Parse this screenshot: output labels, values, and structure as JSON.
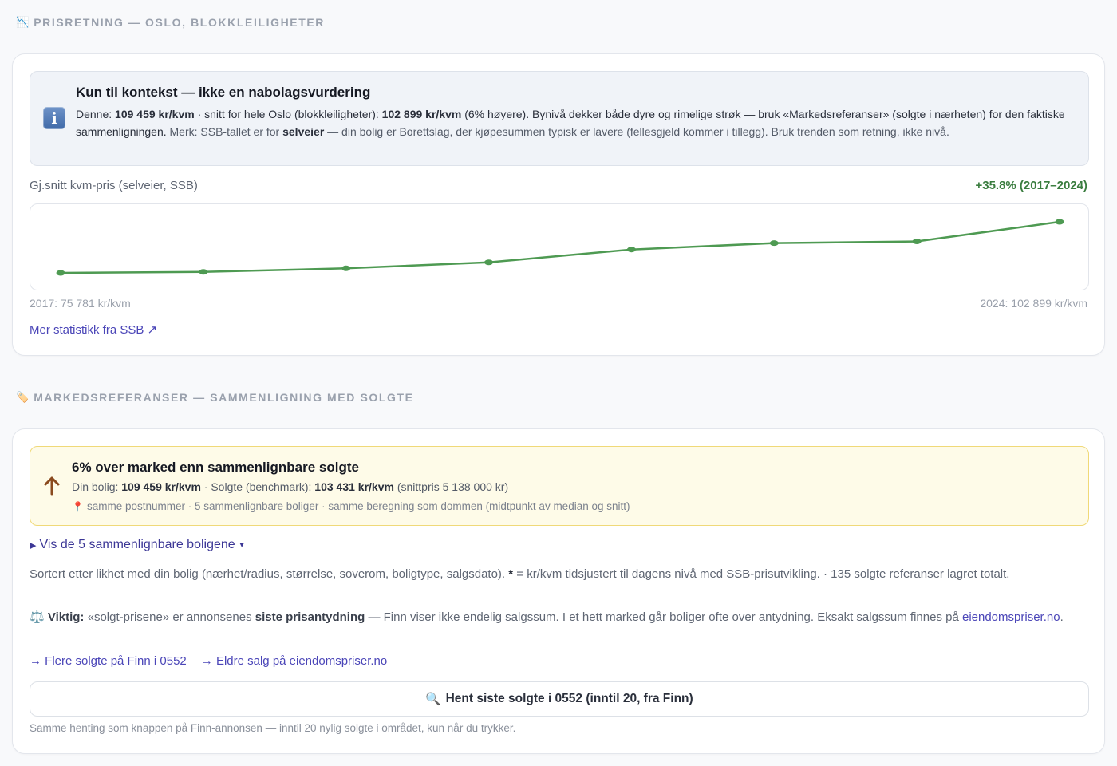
{
  "section1": {
    "icon": "chart-down-icon",
    "title": "PRISRETNING — OSLO, BLOKKLEILIGHETER"
  },
  "context": {
    "icon": "info-icon",
    "title": "Kun til kontekst — ikke en nabolagsvurdering",
    "t1": "Denne: ",
    "b1": "109 459 kr/kvm",
    "t2": " · snitt for hele Oslo (blokkleiligheter): ",
    "b2": "102 899 kr/kvm",
    "t3": " (6% høyere). Bynivå dekker både dyre og rimelige strøk — bruk «Markedsreferanser» (solgte i nærheten) ",
    "t4": "for den faktiske sammenligningen.",
    "t5": " Merk: SSB-tallet er for ",
    "b3": "selveier",
    "t6": " — din bolig er Borettslag, der kjøpesummen typisk er lavere (fellesgjeld kommer i tillegg). Bruk trenden som retning, ikke nivå."
  },
  "trend": {
    "label": "Gj.snitt kvm-pris (selveier, SSB)",
    "change": "+35.8% (2017–2024)",
    "start_label": "2017: 75 781 kr/kvm",
    "end_label": "2024: 102 899 kr/kvm",
    "ssb_link": "Mer statistikk fra SSB ↗",
    "line_color": "#4e9a52"
  },
  "chart_data": {
    "type": "line",
    "x": [
      2017,
      2018,
      2019,
      2020,
      2021,
      2022,
      2023,
      2024
    ],
    "series": [
      {
        "values": [
          75781,
          76300,
          78200,
          81400,
          88200,
          91600,
          92500,
          102899
        ]
      }
    ],
    "ylim": [
      75781,
      102899
    ],
    "grid": false
  },
  "section2": {
    "icon": "tag-icon",
    "title": "MARKEDSREFERANSER — SAMMENLIGNING MED SOLGTE"
  },
  "market": {
    "icon": "arrow-up-icon",
    "title": "6% over marked enn sammenlignbare solgte",
    "l1": "Din bolig: ",
    "b1": "109 459 kr/kvm",
    "l2": " · Solgte (benchmark): ",
    "b2": "103 431 kr/kvm",
    "l3": " (snittpris 5 138 000 kr)",
    "pin_icon": "pin-icon",
    "sub": "samme postnummer · 5 sammenlignbare boliger · samme beregning som dommen (midtpunkt av median og snitt)"
  },
  "details": {
    "toggle": "Vis de 5 sammenlignbare boligene",
    "caret": "▾"
  },
  "sort_text": {
    "a": "Sortert etter likhet med din bolig (nærhet/radius, størrelse, soverom, boligtype, salgsdato). ",
    "star": "*",
    "b": " = kr/kvm tidsjustert til dagens nivå med SSB-prisutvikling. · 135 solgte referanser lagret totalt."
  },
  "important": {
    "icon": "scales-icon",
    "label": "Viktig:",
    "a": " «solgt-prisene» er annonsenes ",
    "b": "siste prisantydning",
    "c": " — Finn viser ikke endelig salgssum. I et hett marked går boliger ofte over antydning. Eksakt salgssum finnes på ",
    "link": "eiendomspriser.no",
    "d": "."
  },
  "links": {
    "finn": "→ Flere solgte på Finn i 0552",
    "eiendom": "→ Eldre salg på eiendomspriser.no"
  },
  "fetch": {
    "icon": "search-icon",
    "label": "Hent siste solgte i 0552 (inntil 20, fra Finn)",
    "note": "Samme henting som knappen på Finn-annonsen — inntil 20 nylig solgte i området, kun når du trykker."
  }
}
